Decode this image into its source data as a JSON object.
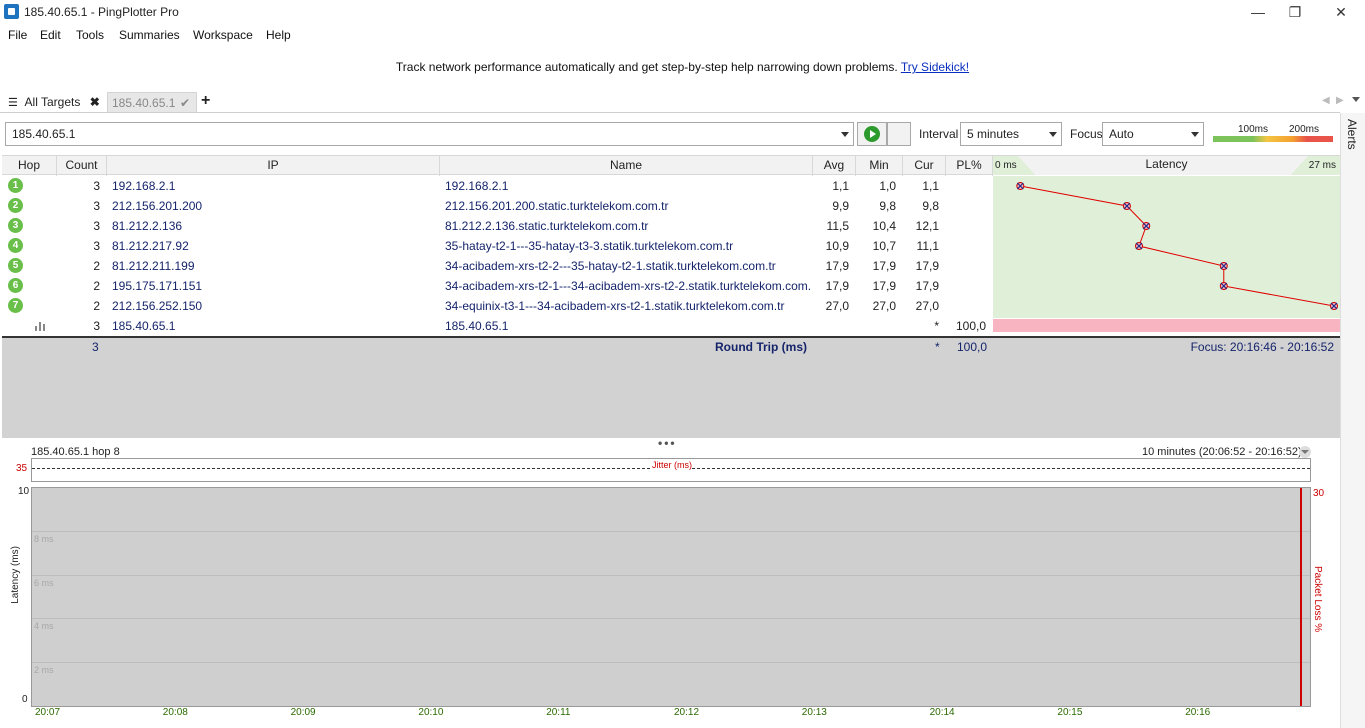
{
  "window": {
    "title": "185.40.65.1 - PingPlotter Pro"
  },
  "menu": [
    "File",
    "Edit",
    "Tools",
    "Summaries",
    "Workspace",
    "Help"
  ],
  "banner": {
    "text": "Track network performance automatically and get step-by-step help narrowing down problems.",
    "link": "Try Sidekick!"
  },
  "tabs": {
    "all_targets": "All Targets",
    "current": "185.40.65.1"
  },
  "toolbar": {
    "target": "185.40.65.1",
    "interval_label": "Interval",
    "interval_value": "5 minutes",
    "focus_label": "Focus",
    "focus_value": "Auto",
    "scale_100": "100ms",
    "scale_200": "200ms"
  },
  "sidebar": {
    "alerts": "Alerts"
  },
  "grid": {
    "headers": {
      "hop": "Hop",
      "count": "Count",
      "ip": "IP",
      "name": "Name",
      "avg": "Avg",
      "min": "Min",
      "cur": "Cur",
      "pl": "PL%",
      "latency": "Latency",
      "lat_min": "0 ms",
      "lat_max": "27 ms"
    },
    "rows": [
      {
        "hop": "1",
        "count": "3",
        "ip": "192.168.2.1",
        "name": "192.168.2.1",
        "avg": "1,1",
        "min": "1,0",
        "cur": "1,1",
        "pl": ""
      },
      {
        "hop": "2",
        "count": "3",
        "ip": "212.156.201.200",
        "name": "212.156.201.200.static.turktelekom.com.tr",
        "avg": "9,9",
        "min": "9,8",
        "cur": "9,8",
        "pl": ""
      },
      {
        "hop": "3",
        "count": "3",
        "ip": "81.212.2.136",
        "name": "81.212.2.136.static.turktelekom.com.tr",
        "avg": "11,5",
        "min": "10,4",
        "cur": "12,1",
        "pl": ""
      },
      {
        "hop": "4",
        "count": "3",
        "ip": "81.212.217.92",
        "name": "35-hatay-t2-1---35-hatay-t3-3.statik.turktelekom.com.tr",
        "avg": "10,9",
        "min": "10,7",
        "cur": "11,1",
        "pl": ""
      },
      {
        "hop": "5",
        "count": "2",
        "ip": "81.212.211.199",
        "name": "34-acibadem-xrs-t2-2---35-hatay-t2-1.statik.turktelekom.com.tr",
        "avg": "17,9",
        "min": "17,9",
        "cur": "17,9",
        "pl": ""
      },
      {
        "hop": "6",
        "count": "2",
        "ip": "195.175.171.151",
        "name": "34-acibadem-xrs-t2-1---34-acibadem-xrs-t2-2.statik.turktelekom.com.tr",
        "avg": "17,9",
        "min": "17,9",
        "cur": "17,9",
        "pl": ""
      },
      {
        "hop": "7",
        "count": "2",
        "ip": "212.156.252.150",
        "name": "34-equinix-t3-1---34-acibadem-xrs-t2-1.statik.turktelekom.com.tr",
        "avg": "27,0",
        "min": "27,0",
        "cur": "27,0",
        "pl": ""
      },
      {
        "hop": "",
        "count": "3",
        "ip": "185.40.65.1",
        "name": "185.40.65.1",
        "avg": "",
        "min": "",
        "cur": "*",
        "pl": "100,0"
      }
    ],
    "roundtrip": {
      "count": "3",
      "label": "Round Trip (ms)",
      "cur": "*",
      "pl": "100,0",
      "focus": "Focus: 20:16:46 - 20:16:52"
    }
  },
  "lower": {
    "title": "185.40.65.1 hop 8",
    "range": "10 minutes (20:06:52 - 20:16:52)",
    "jitter_label": "Jitter (ms)",
    "jitter_max": "35",
    "y_axis_label": "Latency (ms)",
    "y2_axis_label": "Packet Loss %",
    "y_max": "10",
    "y_min": "0",
    "y2_max": "30",
    "gridlines": [
      "8 ms",
      "6 ms",
      "4 ms",
      "2 ms"
    ],
    "x_ticks": [
      "20:07",
      "20:08",
      "20:09",
      "20:10",
      "20:11",
      "20:12",
      "20:13",
      "20:14",
      "20:15",
      "20:16"
    ]
  },
  "colors": {
    "accent": "#15246b",
    "hop_green": "#6abf4b",
    "loss_red": "#cc0000",
    "latency_bg": "#e0f0d8"
  }
}
